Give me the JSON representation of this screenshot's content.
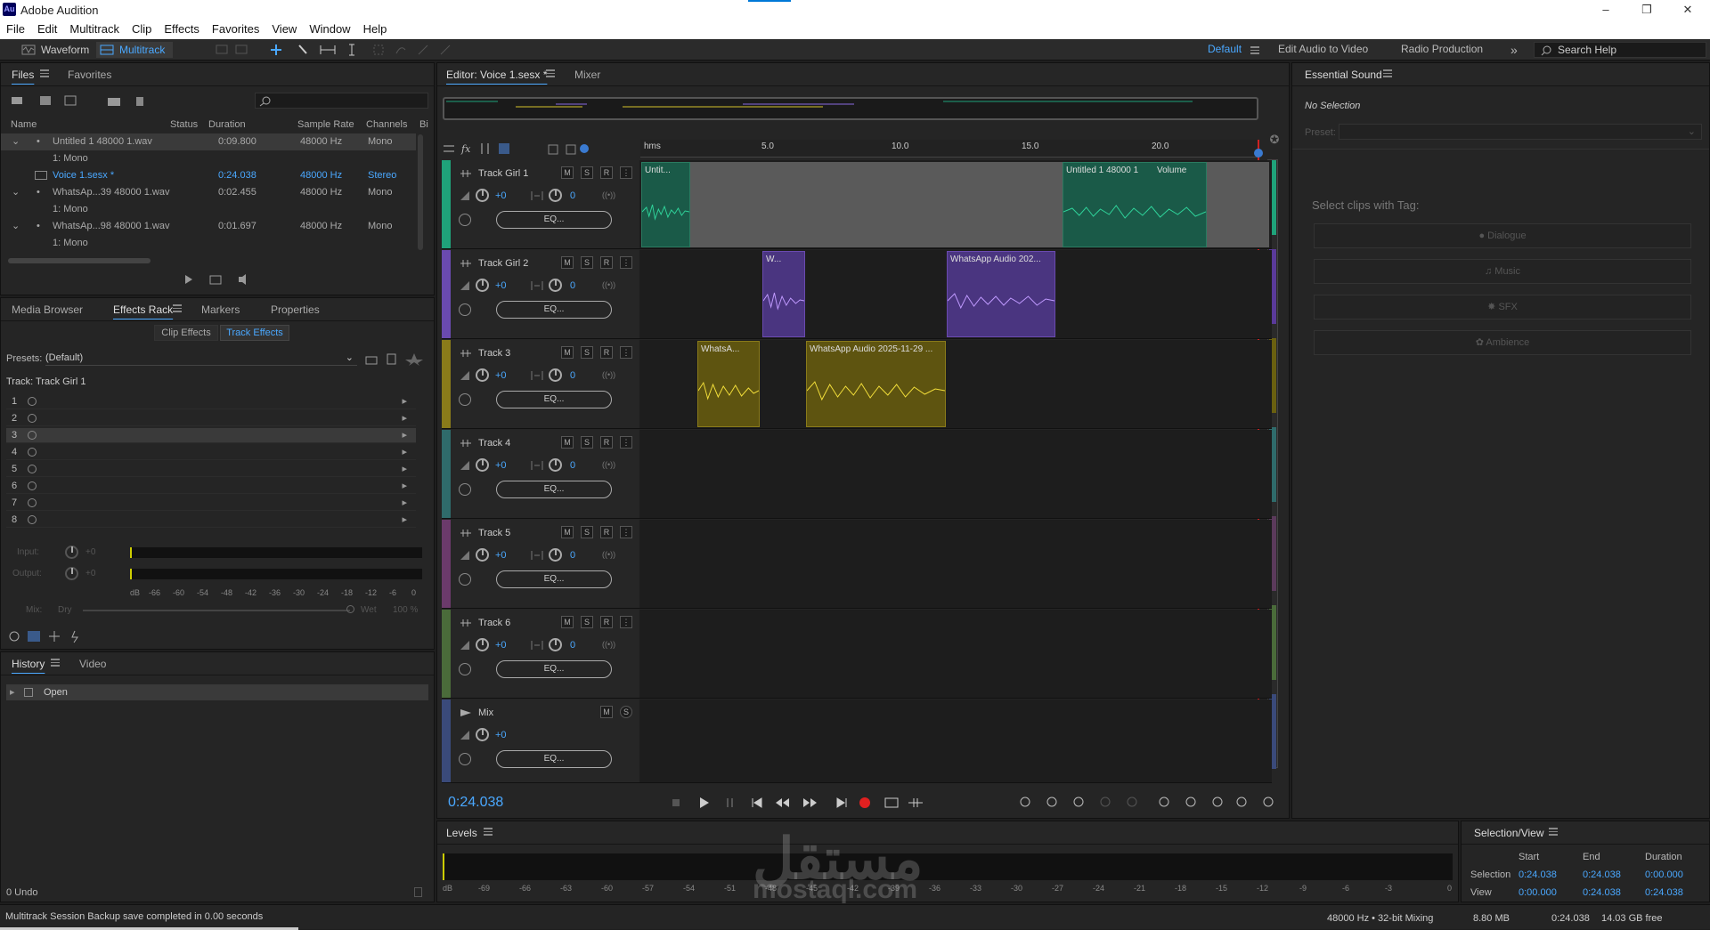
{
  "app": {
    "title": "Adobe Audition",
    "logo": "Au"
  },
  "menu": [
    "File",
    "Edit",
    "Multitrack",
    "Clip",
    "Effects",
    "Favorites",
    "View",
    "Window",
    "Help"
  ],
  "toolbar": {
    "waveform": "Waveform",
    "multitrack": "Multitrack",
    "workspaces": [
      "Default",
      "Edit Audio to Video",
      "Radio Production"
    ],
    "search": "Search Help"
  },
  "files": {
    "tabs": [
      "Files",
      "Favorites"
    ],
    "columns": [
      "Name",
      "Status",
      "Duration",
      "Sample Rate",
      "Channels",
      "Bi"
    ],
    "rows": [
      {
        "name": "Untitled 1 48000 1.wav",
        "duration": "0:09.800",
        "rate": "48000 Hz",
        "channels": "Mono"
      },
      {
        "name": "1: Mono",
        "duration": "",
        "rate": "",
        "channels": ""
      },
      {
        "name": "Voice 1.sesx *",
        "duration": "0:24.038",
        "rate": "48000 Hz",
        "channels": "Stereo"
      },
      {
        "name": "WhatsAp...39 48000 1.wav",
        "duration": "0:02.455",
        "rate": "48000 Hz",
        "channels": "Mono"
      },
      {
        "name": "1: Mono",
        "duration": "",
        "rate": "",
        "channels": ""
      },
      {
        "name": "WhatsAp...98 48000 1.wav",
        "duration": "0:01.697",
        "rate": "48000 Hz",
        "channels": "Mono"
      },
      {
        "name": "1: Mono",
        "duration": "",
        "rate": "",
        "channels": ""
      }
    ]
  },
  "effects": {
    "tabs": [
      "Media Browser",
      "Effects Rack",
      "Markers",
      "Properties"
    ],
    "subtabs": [
      "Clip Effects",
      "Track Effects"
    ],
    "presets_label": "Presets:",
    "preset": "(Default)",
    "track_label": "Track: Track Girl 1",
    "slots": [
      "1",
      "2",
      "3",
      "4",
      "5",
      "6",
      "7",
      "8"
    ],
    "input_label": "Input:",
    "output_label": "Output:",
    "input_val": "+0",
    "output_val": "+0",
    "db_scale": [
      "dB",
      "-66",
      "-60",
      "-54",
      "-48",
      "-42",
      "-36",
      "-30",
      "-24",
      "-18",
      "-12",
      "-6",
      "0"
    ],
    "mix_label": "Mix:",
    "dry": "Dry",
    "wet": "Wet",
    "wet_pct": "100 %"
  },
  "history": {
    "tabs": [
      "History",
      "Video"
    ],
    "item": "Open",
    "undo": "0 Undo"
  },
  "status": {
    "message": "Multitrack Session Backup save completed in 0.00 seconds",
    "format": "48000 Hz • 32-bit Mixing",
    "mem": "8.80 MB",
    "dur": "0:24.038",
    "free": "14.03 GB free"
  },
  "editor": {
    "tab": "Editor: Voice 1.sesx *",
    "mixer": "Mixer",
    "ruler": [
      "hms",
      "5.0",
      "10.0",
      "15.0",
      "20.0"
    ],
    "time": "0:24.038",
    "tracks": [
      {
        "name": "Track Girl 1",
        "vol": "+0",
        "pan": "0",
        "eq": "EQ...",
        "color": "#1fa37a"
      },
      {
        "name": "Track Girl 2",
        "vol": "+0",
        "pan": "0",
        "eq": "EQ...",
        "color": "#6a4ab0"
      },
      {
        "name": "Track 3",
        "vol": "+0",
        "pan": "0",
        "eq": "EQ...",
        "color": "#8a7b1a"
      },
      {
        "name": "Track 4",
        "vol": "+0",
        "pan": "0",
        "eq": "EQ...",
        "color": "#2f6b6b"
      },
      {
        "name": "Track 5",
        "vol": "+0",
        "pan": "0",
        "eq": "EQ...",
        "color": "#6b3a6b"
      },
      {
        "name": "Track 6",
        "vol": "+0",
        "pan": "0",
        "eq": "EQ...",
        "color": "#4a6b3a"
      },
      {
        "name": "Mix",
        "vol": "+0",
        "eq": "EQ...",
        "color": "#3a4a7a"
      }
    ],
    "clips": {
      "c1": "Untit...",
      "c2": "Untitled 1 48000 1",
      "c2v": "Volume",
      "c3": "W...",
      "c4": "WhatsApp Audio 202...",
      "c5": "WhatsA...",
      "c6": "WhatsApp Audio 2025-11-29 ..."
    }
  },
  "essential": {
    "title": "Essential Sound",
    "nosel": "No Selection",
    "preset": "Preset:",
    "tag_label": "Select clips with Tag:",
    "tags": [
      "Dialogue",
      "Music",
      "SFX",
      "Ambience"
    ]
  },
  "levels": {
    "title": "Levels",
    "scale": [
      "dB",
      "-69",
      "-66",
      "-63",
      "-60",
      "-57",
      "-54",
      "-51",
      "-48",
      "-45",
      "-42",
      "-39",
      "-36",
      "-33",
      "-30",
      "-27",
      "-24",
      "-21",
      "-18",
      "-15",
      "-12",
      "-9",
      "-6",
      "-3",
      "0"
    ]
  },
  "selview": {
    "title": "Selection/View",
    "headers": [
      "Start",
      "End",
      "Duration"
    ],
    "sel_label": "Selection",
    "view_label": "View",
    "sel": [
      "0:24.038",
      "0:24.038",
      "0:00.000"
    ],
    "view": [
      "0:00.000",
      "0:24.038",
      "0:24.038"
    ]
  },
  "watermark": {
    "arabic": "مستقل",
    "latin": "mostaql.com"
  }
}
